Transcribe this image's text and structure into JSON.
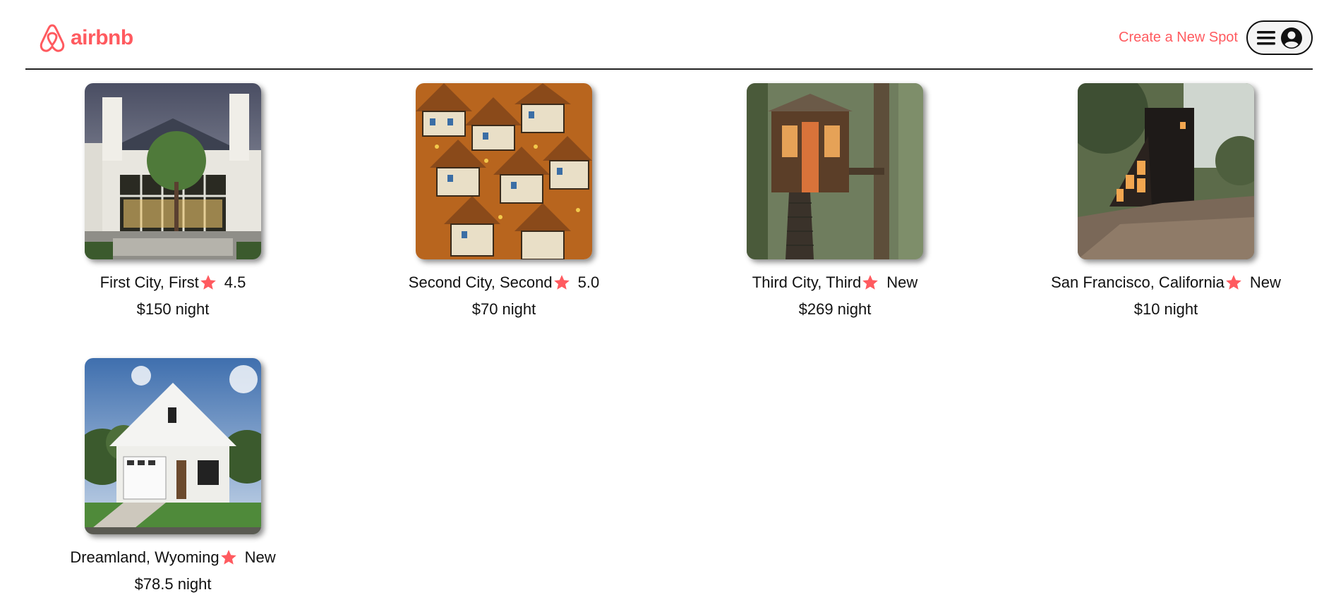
{
  "header": {
    "logo_text": "airbnb",
    "create_spot_label": "Create a New Spot"
  },
  "colors": {
    "brand": "#FF5A5F"
  },
  "spots": [
    {
      "location": "First City, First",
      "rating": "4.5",
      "price": "$150 night",
      "image": "modern-white-house"
    },
    {
      "location": "Second City, Second",
      "rating": "5.0",
      "price": "$70 night",
      "image": "miniature-village"
    },
    {
      "location": "Third City, Third",
      "rating": "New",
      "price": "$269 night",
      "image": "treehouse"
    },
    {
      "location": "San Francisco, California",
      "rating": "New",
      "price": "$10 night",
      "image": "a-frame-cabin"
    },
    {
      "location": "Dreamland, Wyoming",
      "rating": "New",
      "price": "$78.5 night",
      "image": "farmhouse"
    }
  ]
}
